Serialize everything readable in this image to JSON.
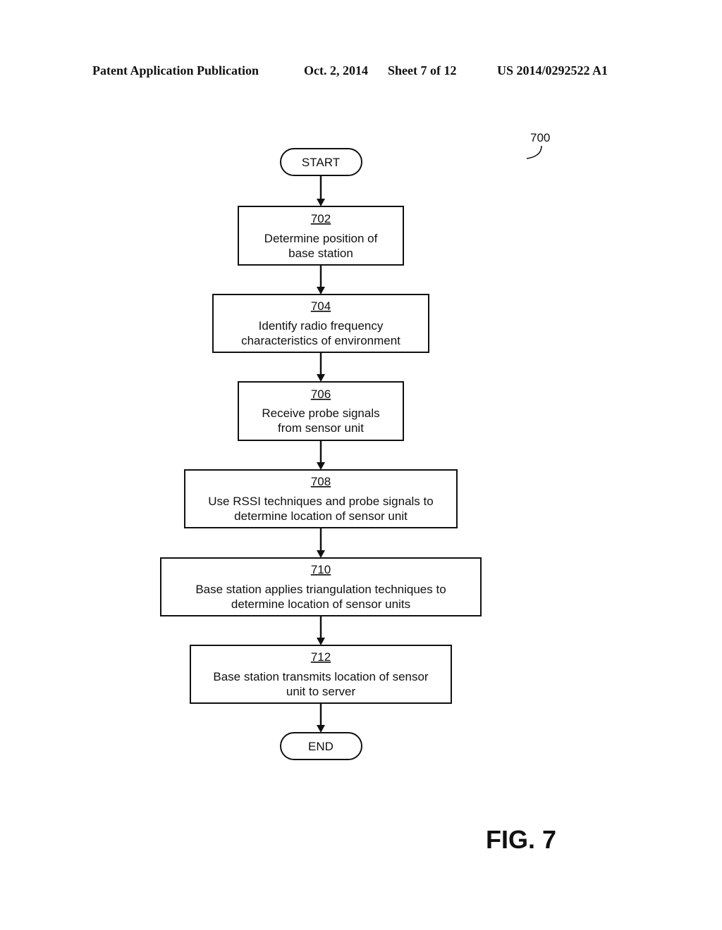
{
  "header": {
    "publication": "Patent Application Publication",
    "date": "Oct. 2, 2014",
    "sheet": "Sheet 7 of 12",
    "number": "US 2014/0292522 A1"
  },
  "diagram": {
    "reference": "700",
    "figure_label": "FIG. 7",
    "start_label": "START",
    "end_label": "END",
    "steps": [
      {
        "id": "702",
        "lines": [
          "Determine position of",
          "base station"
        ]
      },
      {
        "id": "704",
        "lines": [
          "Identify radio frequency",
          "characteristics of environment"
        ]
      },
      {
        "id": "706",
        "lines": [
          "Receive probe signals",
          "from sensor unit"
        ]
      },
      {
        "id": "708",
        "lines": [
          "Use RSSI techniques and probe signals to",
          "determine location of sensor unit"
        ]
      },
      {
        "id": "710",
        "lines": [
          "Base station applies triangulation techniques to",
          "determine location of sensor units"
        ]
      },
      {
        "id": "712",
        "lines": [
          "Base station transmits location of sensor",
          "unit to server"
        ]
      }
    ]
  }
}
